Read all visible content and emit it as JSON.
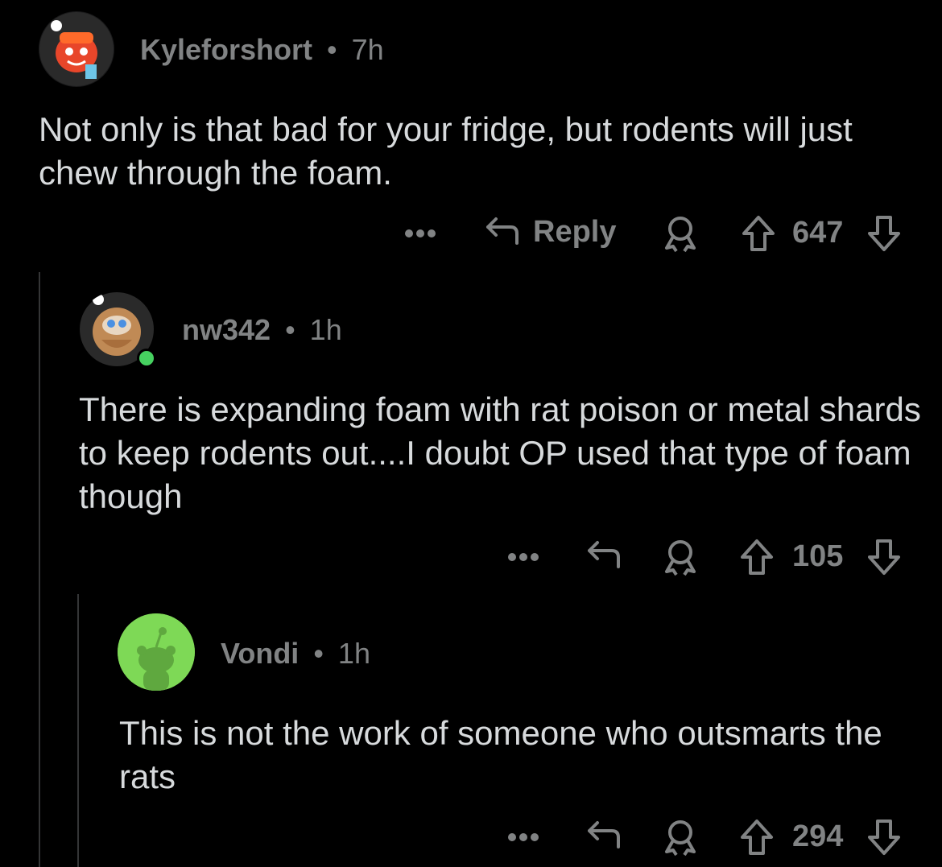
{
  "comments": [
    {
      "username": "Kyleforshort",
      "separator": "•",
      "time": "7h",
      "text": "Not only is that bad for your fridge, but rodents will just chew through the foam.",
      "more_icon": "more-dots-icon",
      "reply_label": "Reply",
      "award_icon": "award-icon",
      "score": "647"
    },
    {
      "username": "nw342",
      "separator": "•",
      "time": "1h",
      "text": "There is expanding foam with rat poison or metal shards to keep rodents out....I doubt OP used that type of foam though",
      "more_icon": "more-dots-icon",
      "award_icon": "award-icon",
      "score": "105"
    },
    {
      "username": "Vondi",
      "separator": "•",
      "time": "1h",
      "text": "This is not the work of someone who outsmarts the rats",
      "more_icon": "more-dots-icon",
      "award_icon": "award-icon",
      "score": "294"
    }
  ],
  "colors": {
    "background": "#000000",
    "text": "#d7dadc",
    "meta": "#818384",
    "online": "#46d160",
    "default_avatar": "#7ed956"
  }
}
